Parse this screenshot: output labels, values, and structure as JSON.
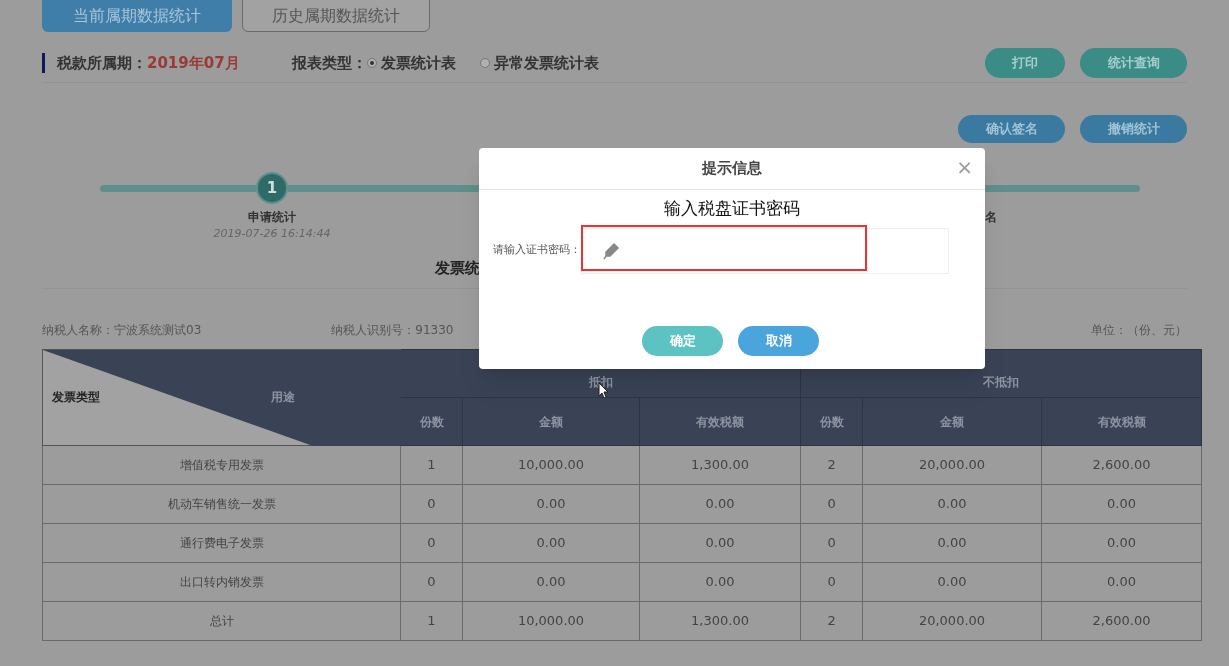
{
  "tabs": [
    {
      "label": "当前属期数据统计",
      "selected": true
    },
    {
      "label": "历史属期数据统计",
      "selected": false
    }
  ],
  "period": {
    "label": "税款所属期：",
    "value": "2019年07月"
  },
  "report_type": {
    "label": "报表类型：",
    "options": [
      {
        "label": "发票统计表",
        "selected": true
      },
      {
        "label": "异常发票统计表",
        "selected": false
      }
    ]
  },
  "top_buttons": [
    "打印",
    "统计查询"
  ],
  "action_buttons": [
    "确认签名",
    "撤销统计"
  ],
  "steps": [
    {
      "number": "1",
      "label": "申请统计",
      "time": "2019-07-26 16:14:44"
    },
    {
      "label": "名"
    }
  ],
  "report_title": "发票统",
  "taxpayer_name": "纳税人名称：宁波系统测试03",
  "taxpayer_id": "纳税人识别号：91330",
  "unit": "单位：（份、元）",
  "table": {
    "corner": {
      "row_label": "发票类型",
      "col_label": "用途"
    },
    "groups": [
      "抵扣",
      "不抵扣"
    ],
    "columns": [
      "份数",
      "金额",
      "有效税额",
      "份数",
      "金额",
      "有效税额"
    ],
    "rows": [
      {
        "type": "增值税专用发票",
        "cells": [
          "1",
          "10,000.00",
          "1,300.00",
          "2",
          "20,000.00",
          "2,600.00"
        ]
      },
      {
        "type": "机动车销售统一发票",
        "cells": [
          "0",
          "0.00",
          "0.00",
          "0",
          "0.00",
          "0.00"
        ]
      },
      {
        "type": "通行费电子发票",
        "cells": [
          "0",
          "0.00",
          "0.00",
          "0",
          "0.00",
          "0.00"
        ]
      },
      {
        "type": "出口转内销发票",
        "cells": [
          "0",
          "0.00",
          "0.00",
          "0",
          "0.00",
          "0.00"
        ]
      },
      {
        "type": "总计",
        "cells": [
          "1",
          "10,000.00",
          "1,300.00",
          "2",
          "20,000.00",
          "2,600.00"
        ]
      }
    ]
  },
  "dialog": {
    "title": "提示信息",
    "close": "×",
    "annotation": "输入税盘证书密码",
    "field": {
      "label": "请输入证书密码：",
      "highlighted": true
    },
    "buttons": [
      {
        "label": "确定",
        "kind": "confirm"
      },
      {
        "label": "取消",
        "kind": "cancel"
      }
    ]
  }
}
